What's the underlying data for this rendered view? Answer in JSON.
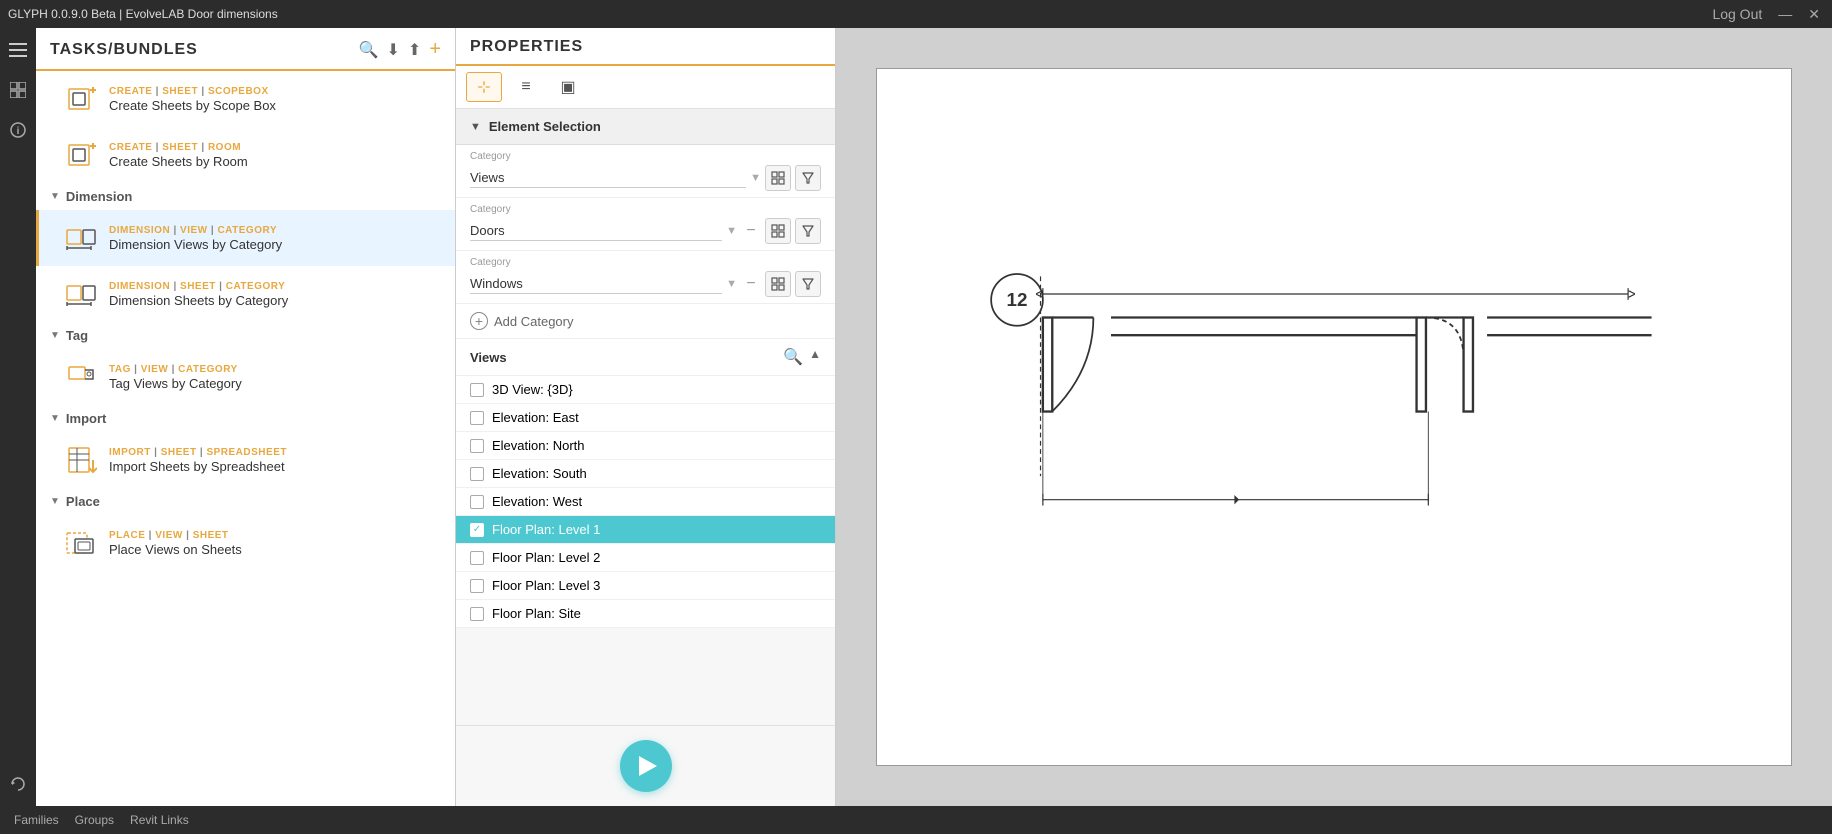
{
  "titlebar": {
    "title": "GLYPH 0.0.9.0 Beta | EvolveLAB  Door dimensions",
    "logout": "Log Out",
    "minimize": "—",
    "close": "✕"
  },
  "tasks_panel": {
    "title": "TASKS/BUNDLES",
    "sections": [
      {
        "id": "create-sheet",
        "label": "Create Sheet",
        "items": [
          {
            "id": "create-sheet-scopebox",
            "label_parts": [
              "CREATE",
              "SHEET",
              "SCOPEBOX"
            ],
            "name": "Create Sheets by Scope Box"
          },
          {
            "id": "create-sheet-room",
            "label_parts": [
              "CREATE",
              "SHEET",
              "ROOM"
            ],
            "name": "Create Sheets by Room"
          }
        ]
      },
      {
        "id": "dimension",
        "label": "Dimension",
        "items": [
          {
            "id": "dim-view-category",
            "label_parts": [
              "DIMENSION",
              "VIEW",
              "CATEGORY"
            ],
            "name": "Dimension Views by Category",
            "active": true
          },
          {
            "id": "dim-sheet-category",
            "label_parts": [
              "DIMENSION",
              "SHEET",
              "CATEGORY"
            ],
            "name": "Dimension Sheets by Category"
          }
        ]
      },
      {
        "id": "tag",
        "label": "Tag",
        "items": [
          {
            "id": "tag-view-category",
            "label_parts": [
              "TAG",
              "VIEW",
              "CATEGORY"
            ],
            "name": "Tag Views by Category"
          }
        ]
      },
      {
        "id": "import",
        "label": "Import",
        "items": [
          {
            "id": "import-sheet-spreadsheet",
            "label_parts": [
              "IMPORT",
              "SHEET",
              "SPREADSHEET"
            ],
            "name": "Import Sheets by Spreadsheet"
          }
        ]
      },
      {
        "id": "place",
        "label": "Place",
        "items": [
          {
            "id": "place-view-sheet",
            "label_parts": [
              "PLACE",
              "VIEW",
              "SHEET"
            ],
            "name": "Place Views on Sheets"
          }
        ]
      }
    ]
  },
  "properties_panel": {
    "title": "PROPERTIES",
    "tabs": [
      {
        "id": "selection",
        "icon": "⊹",
        "label": "element-selection-tab",
        "active": true
      },
      {
        "id": "params",
        "icon": "≡",
        "label": "params-tab",
        "active": false
      },
      {
        "id": "output",
        "icon": "▣",
        "label": "output-tab",
        "active": false
      }
    ],
    "element_selection": {
      "section_label": "Element Selection",
      "categories": [
        {
          "label": "Category",
          "value": "Views",
          "has_minus": false
        },
        {
          "label": "Category",
          "value": "Doors",
          "has_minus": true
        },
        {
          "label": "Category",
          "value": "Windows",
          "has_minus": true
        }
      ],
      "add_category_label": "Add Category"
    },
    "views": {
      "header": "Views",
      "items": [
        {
          "id": "3d-view",
          "label": "3D View: {3D}",
          "checked": false
        },
        {
          "id": "elev-east",
          "label": "Elevation: East",
          "checked": false
        },
        {
          "id": "elev-north",
          "label": "Elevation: North",
          "checked": false
        },
        {
          "id": "elev-south",
          "label": "Elevation: South",
          "checked": false
        },
        {
          "id": "elev-west",
          "label": "Elevation: West",
          "checked": false
        },
        {
          "id": "fp-level1",
          "label": "Floor Plan: Level 1",
          "checked": true
        },
        {
          "id": "fp-level2",
          "label": "Floor Plan: Level 2",
          "checked": false
        },
        {
          "id": "fp-level3",
          "label": "Floor Plan: Level 3",
          "checked": false
        },
        {
          "id": "fp-site",
          "label": "Floor Plan: Site",
          "checked": false
        }
      ]
    }
  },
  "drawing": {
    "circle_label": "12"
  },
  "bottom_bar": {
    "items": [
      "Families",
      "Groups",
      "Revit Links"
    ]
  }
}
